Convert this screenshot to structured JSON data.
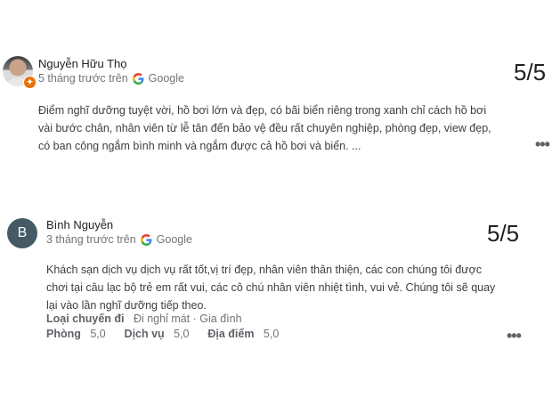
{
  "reviews": [
    {
      "author": "Nguyễn Hữu Thọ",
      "time": "5 tháng trước trên",
      "source": "Google",
      "rating": "5/5",
      "text_lines": [
        "Điểm nghĩ dưỡng tuyệt vời, hồ bơi lớn và đẹp, có bãi biển riêng trong xanh chỉ cách hồ bơi",
        "vài bước chân, nhân viên từ lễ tân đến bảo vệ đều rất chuyên nghiệp, phòng đẹp, view đẹp,",
        "có ban công ngắm bình minh và ngắm được cả hồ bơi và biển. ..."
      ],
      "more_label": "•••"
    },
    {
      "author": "Bình Nguyễn",
      "avatar_letter": "B",
      "time": "3 tháng trước trên",
      "source": "Google",
      "rating": "5/5",
      "text_lines": [
        "Khách sạn dịch vụ dịch vụ rất tốt,vị trí đẹp, nhân viên thân thiện, các con chúng tôi được",
        "chơi tại câu lạc bộ trẻ em rất vui, các cô chú nhân viên nhiệt tình, vui vẻ. Chúng tôi sẽ quay",
        "lại vào lần nghĩ dưỡng tiếp theo."
      ],
      "trip_label": "Loại chuyến đi",
      "trip_value": "Đi nghỉ mát · Gia đình",
      "scores": [
        {
          "label": "Phòng",
          "value": "5,0"
        },
        {
          "label": "Dịch vụ",
          "value": "5,0"
        },
        {
          "label": "Địa điểm",
          "value": "5,0"
        }
      ],
      "more_label": "•••"
    }
  ]
}
